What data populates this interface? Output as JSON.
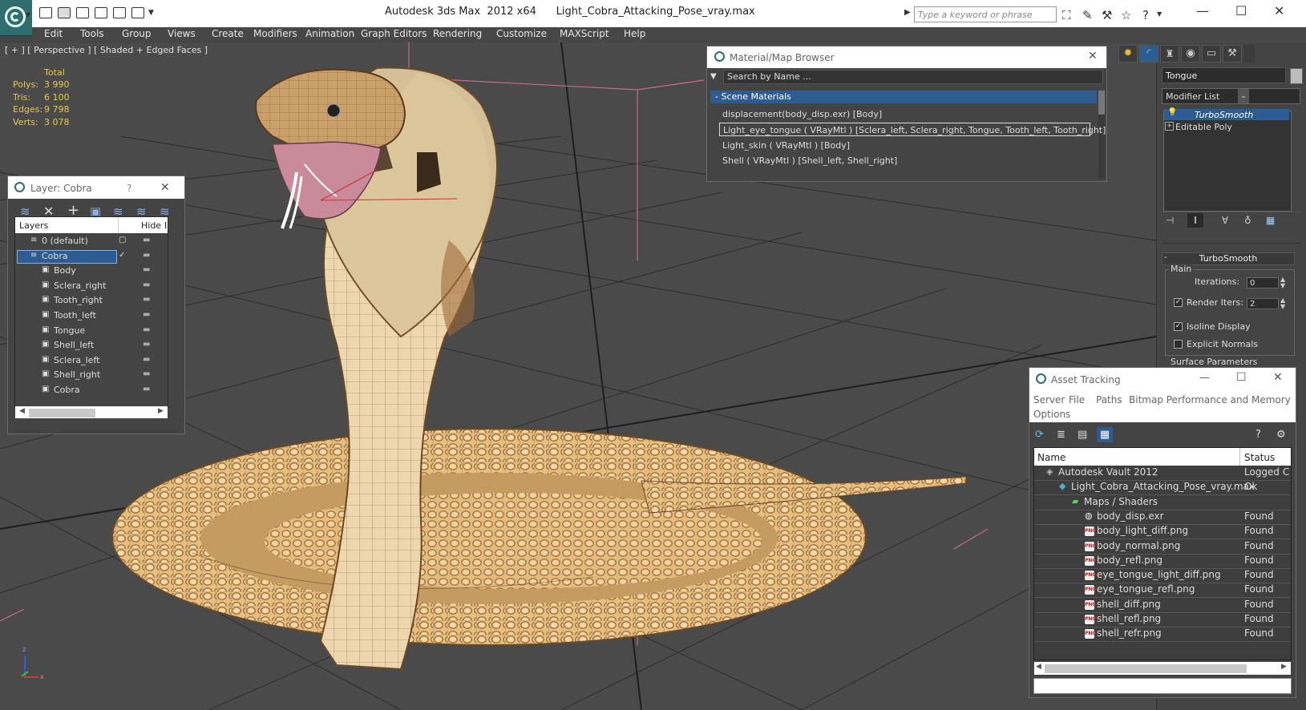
{
  "window": {
    "title": "Autodesk 3ds Max  2012 x64      Light_Cobra_Attacking_Pose_vray.max",
    "search_placeholder": "Type a keyword or phrase"
  },
  "menu": [
    "Edit",
    "Tools",
    "Group",
    "Views",
    "Create",
    "Modifiers",
    "Animation",
    "Graph Editors",
    "Rendering",
    "Customize",
    "MAXScript",
    "Help"
  ],
  "viewport": {
    "label": "[ + ] [ Perspective ] [ Shaded + Edged Faces ]",
    "stats": {
      "total_label": "Total",
      "rows": [
        {
          "label": "Polys:",
          "value": "3 990"
        },
        {
          "label": "Tris:",
          "value": "6 100"
        },
        {
          "label": "Edges:",
          "value": "9 798"
        },
        {
          "label": "Verts:",
          "value": "3 078"
        }
      ]
    },
    "axis": {
      "x": "x",
      "y": "y",
      "z": "z"
    }
  },
  "layer_window": {
    "title": "Layer: Cobra",
    "help": "?",
    "col_layers": "Layers",
    "col_hide": "Hide",
    "col_more": "I",
    "rows": [
      {
        "name": "0 (default)"
      },
      {
        "name": "Cobra"
      },
      {
        "name": "Body"
      },
      {
        "name": "Sclera_right"
      },
      {
        "name": "Tooth_right"
      },
      {
        "name": "Tooth_left"
      },
      {
        "name": "Tongue"
      },
      {
        "name": "Shell_left"
      },
      {
        "name": "Sclera_left"
      },
      {
        "name": "Shell_right"
      },
      {
        "name": "Cobra"
      }
    ]
  },
  "material_browser": {
    "title": "Material/Map Browser",
    "search_placeholder": "Search by Name ...",
    "group": "- Scene Materials",
    "items": [
      "displacement(body_disp.exr) [Body]",
      "Light_eye_tongue  ( VRayMtl )  [Sclera_left, Sclera_right, Tongue, Tooth_left, Tooth_right]",
      "Light_skin  ( VRayMtl )  [Body]",
      "Shell  ( VRayMtl )  [Shell_left, Shell_right]"
    ]
  },
  "command_panel": {
    "object_name": "Tongue",
    "modifier_list": "Modifier List",
    "stack": [
      "TurboSmooth",
      "Editable Poly"
    ],
    "rollout_title": "TurboSmooth",
    "group_main": "Main",
    "iterations_label": "Iterations:",
    "iterations_value": "0",
    "render_iters_label": "Render Iters:",
    "render_iters_value": "2",
    "isoline_label": "Isoline Display",
    "explicit_label": "Explicit Normals",
    "surface_label": "Surface Parameters"
  },
  "asset_tracking": {
    "title": "Asset Tracking",
    "menu": [
      "Server",
      "File",
      "Paths",
      "Bitmap Performance and Memory",
      "Options"
    ],
    "col_name": "Name",
    "col_status": "Status",
    "rows": [
      {
        "name": "Autodesk Vault 2012",
        "status": "Logged C",
        "indent": 0,
        "icon": "vault"
      },
      {
        "name": "Light_Cobra_Attacking_Pose_vray.max",
        "status": "Ok",
        "indent": 1,
        "icon": "max"
      },
      {
        "name": "Maps / Shaders",
        "status": "",
        "indent": 2,
        "icon": "maps"
      },
      {
        "name": "body_disp.exr",
        "status": "Found",
        "indent": 3,
        "icon": "exr"
      },
      {
        "name": "body_light_diff.png",
        "status": "Found",
        "indent": 3,
        "icon": "png"
      },
      {
        "name": "body_normal.png",
        "status": "Found",
        "indent": 3,
        "icon": "png"
      },
      {
        "name": "body_refl.png",
        "status": "Found",
        "indent": 3,
        "icon": "png"
      },
      {
        "name": "eye_tongue_light_diff.png",
        "status": "Found",
        "indent": 3,
        "icon": "png"
      },
      {
        "name": "eye_tongue_refl.png",
        "status": "Found",
        "indent": 3,
        "icon": "png"
      },
      {
        "name": "shell_diff.png",
        "status": "Found",
        "indent": 3,
        "icon": "png"
      },
      {
        "name": "shell_refl.png",
        "status": "Found",
        "indent": 3,
        "icon": "png"
      },
      {
        "name": "shell_refr.png",
        "status": "Found",
        "indent": 3,
        "icon": "png"
      }
    ],
    "png_badge": "PNG"
  },
  "colors": {
    "accent": "#1e5aa8",
    "stats": "#e8c84a",
    "snake_light": "#e7c894",
    "snake_dark": "#b98a4e"
  }
}
